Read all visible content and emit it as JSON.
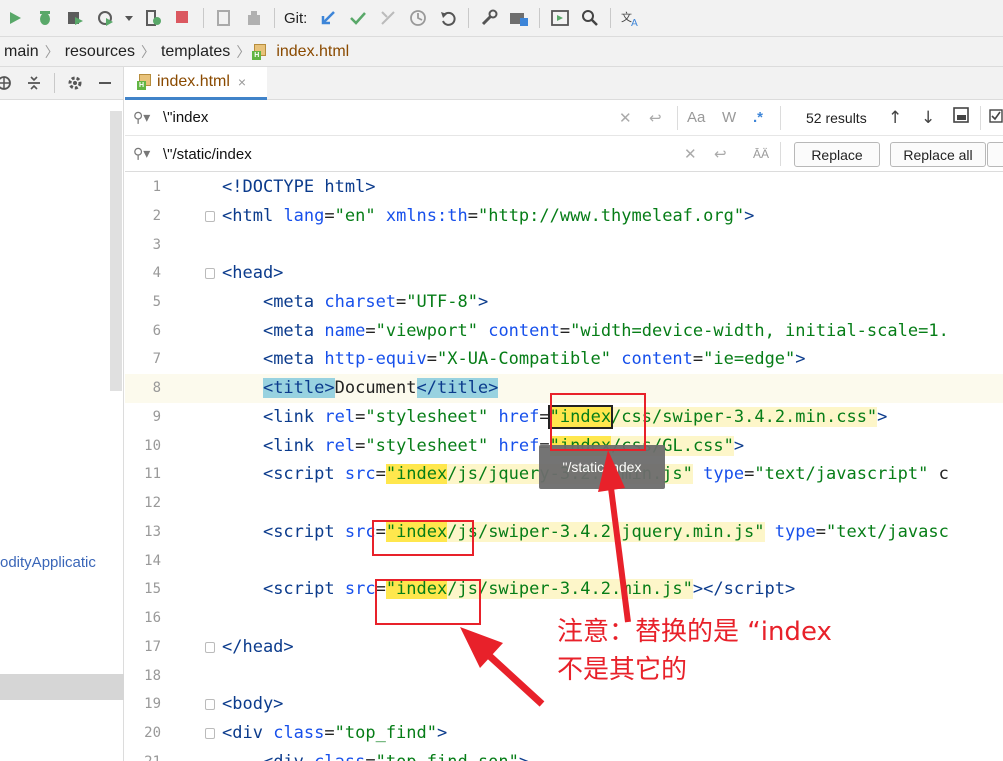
{
  "toolbar": {
    "git_label": "Git:",
    "icons": [
      "run-icon",
      "debug-icon",
      "coverage-icon",
      "profile-icon",
      "dropdown-icon",
      "build-icon",
      "stop-icon",
      "gradle-icon",
      "plugin-icon",
      "git-update-icon",
      "git-commit-icon",
      "git-merge-icon",
      "history-icon",
      "rollback-icon",
      "wrench-icon",
      "project-structure-icon",
      "run-config-icon",
      "search-icon",
      "translate-icon"
    ]
  },
  "breadcrumb": {
    "items": [
      "main",
      "resources",
      "templates",
      "index.html"
    ]
  },
  "sidebar": {
    "item_label": "odityApplicatic"
  },
  "tab": {
    "label": "index.html",
    "close": "×"
  },
  "search": {
    "find_value": "\\\"index",
    "replace_value": "\\\"/static/index",
    "results_count": "52 results",
    "case_option": "Aa",
    "word_option": "W",
    "regex_option": ".*",
    "replace_button": "Replace",
    "replace_all_button": "Replace all"
  },
  "editor": {
    "lines": [
      "1",
      "2",
      "3",
      "4",
      "5",
      "6",
      "7",
      "8",
      "9",
      "10",
      "11",
      "12",
      "13",
      "14",
      "15",
      "16",
      "17",
      "18",
      "19",
      "20",
      "21"
    ],
    "tooltip": "\"/static/index"
  },
  "annotation": {
    "line1": "注意：替换的是 “index",
    "line2": "不是其它的"
  },
  "colors": {
    "highlight": "#ffe74d",
    "annotation_red": "#e8212a",
    "tag_blue": "#0b3b8c",
    "string_green": "#067d17"
  }
}
